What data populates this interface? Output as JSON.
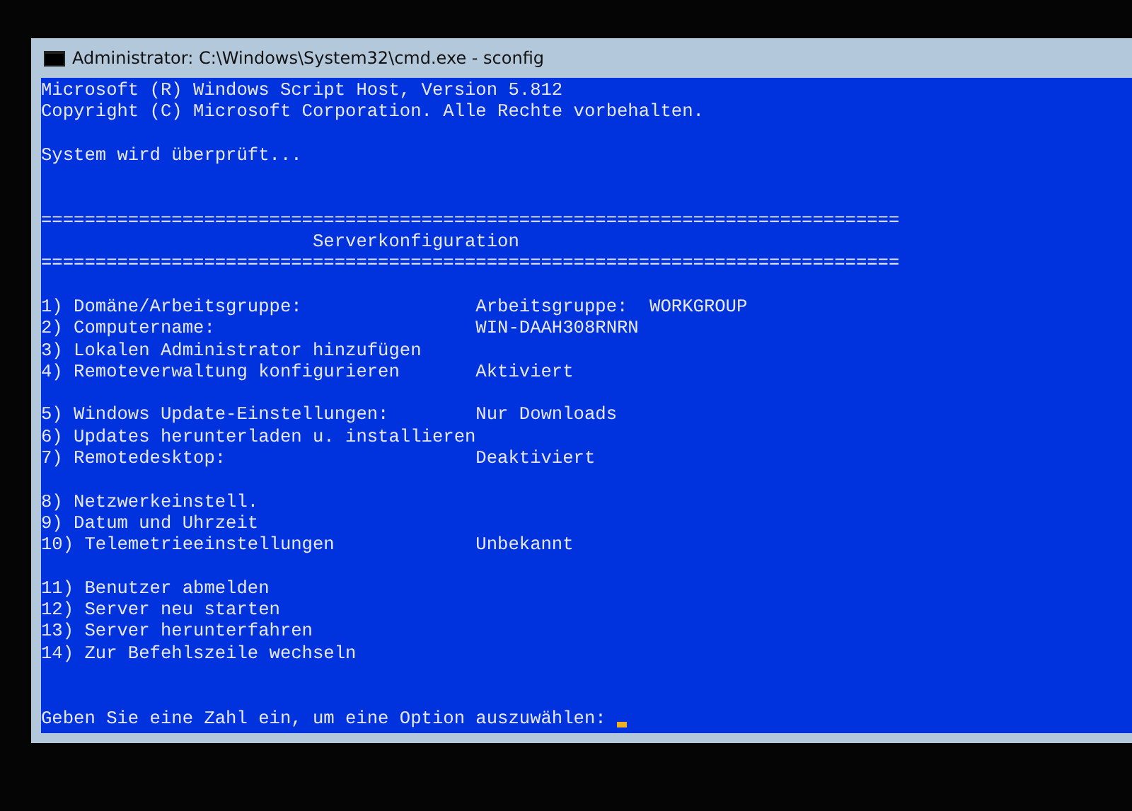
{
  "window": {
    "title": "Administrator: C:\\Windows\\System32\\cmd.exe - sconfig"
  },
  "header_lines": [
    "Microsoft (R) Windows Script Host, Version 5.812",
    "Copyright (C) Microsoft Corporation. Alle Rechte vorbehalten."
  ],
  "status_text": "System wird überprüft...",
  "separator_top": "===============================================================================",
  "heading": "Serverkonfiguration",
  "separator_bottom": "===============================================================================",
  "menu_groups": [
    [
      {
        "label": "1) Domäne/Arbeitsgruppe:",
        "value": "Arbeitsgruppe:  WORKGROUP"
      },
      {
        "label": "2) Computername:",
        "value": "WIN-DAAH308RNRN"
      },
      {
        "label": "3) Lokalen Administrator hinzufügen"
      },
      {
        "label": "4) Remoteverwaltung konfigurieren",
        "value": "Aktiviert"
      }
    ],
    [
      {
        "label": "5) Windows Update-Einstellungen:",
        "value": "Nur Downloads"
      },
      {
        "label": "6) Updates herunterladen u. installieren"
      },
      {
        "label": "7) Remotedesktop:",
        "value": "Deaktiviert"
      }
    ],
    [
      {
        "label": "8) Netzwerkeinstell."
      },
      {
        "label": "9) Datum und Uhrzeit"
      },
      {
        "label": "10) Telemetrieeinstellungen",
        "value": "Unbekannt"
      }
    ],
    [
      {
        "label": "11) Benutzer abmelden"
      },
      {
        "label": "12) Server neu starten"
      },
      {
        "label": "13) Server herunterfahren"
      },
      {
        "label": "14) Zur Befehlszeile wechseln"
      }
    ]
  ],
  "prompt": "Geben Sie eine Zahl ein, um eine Option auszuwählen:"
}
